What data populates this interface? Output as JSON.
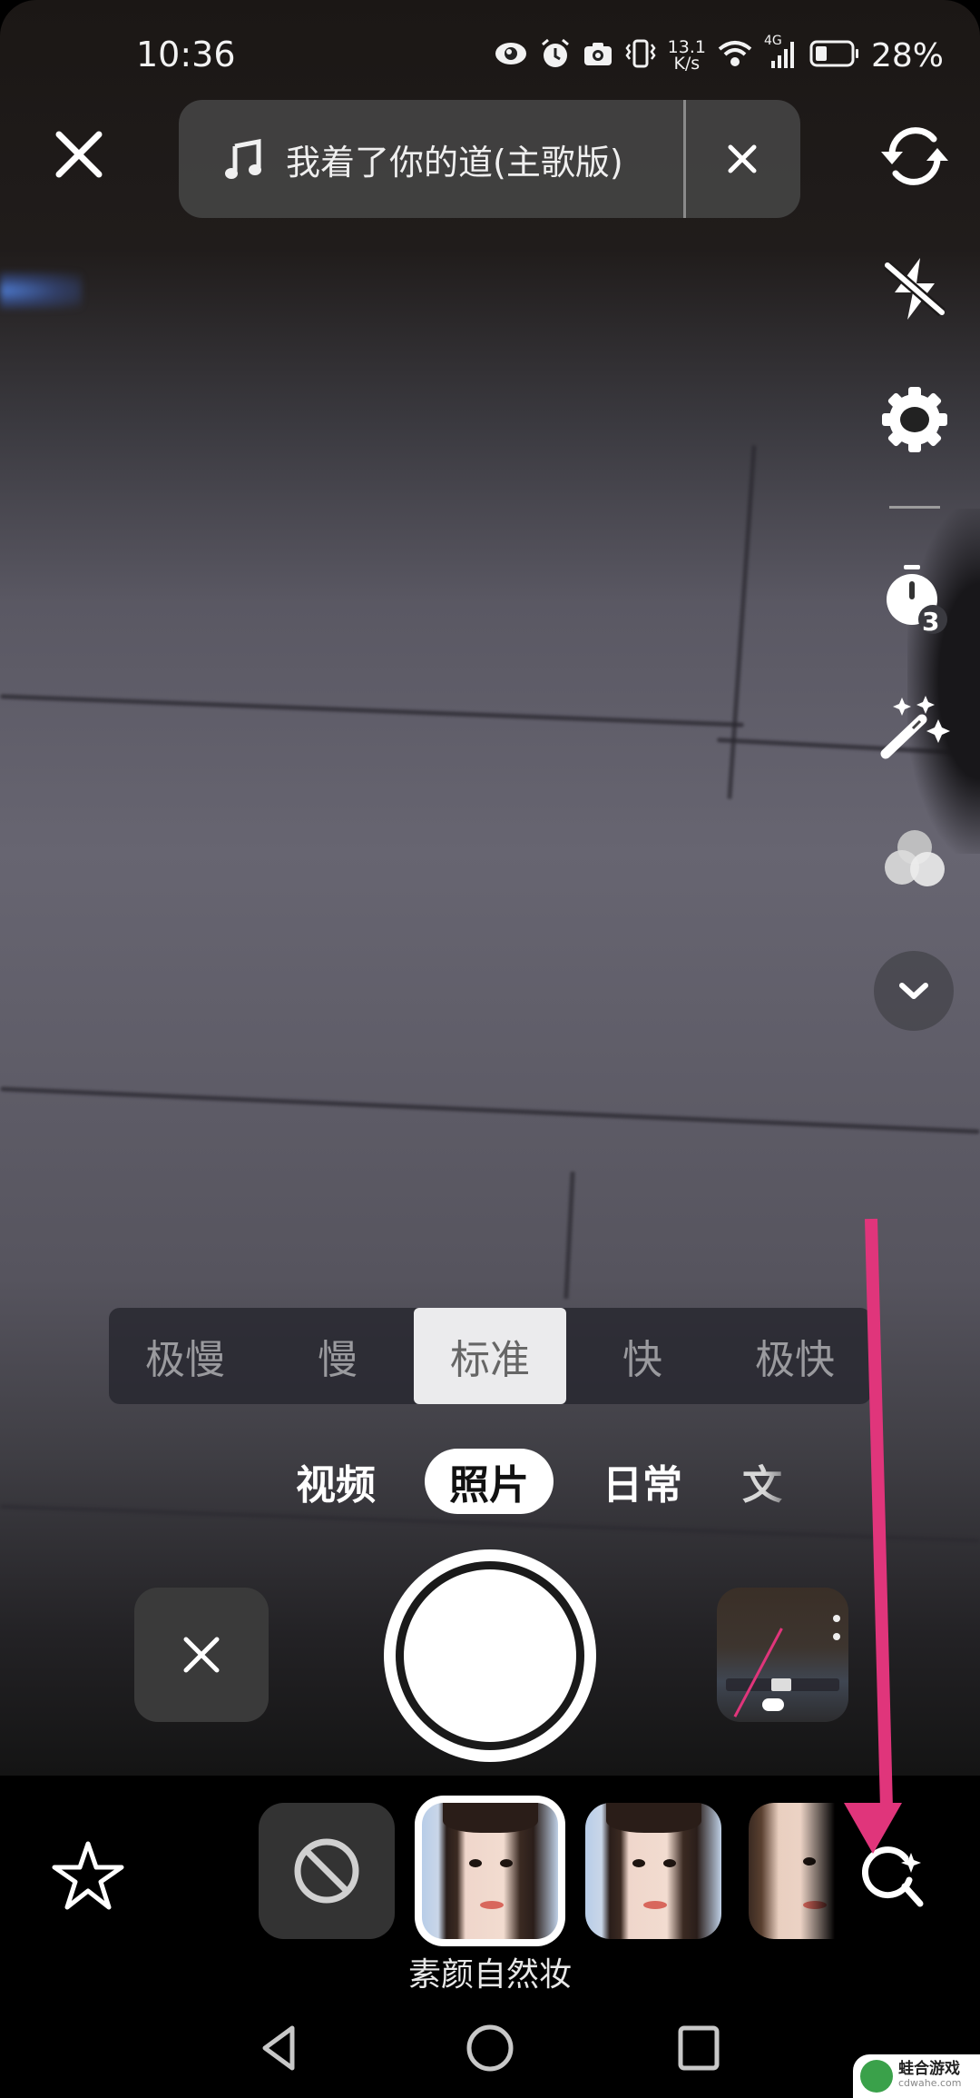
{
  "status_bar": {
    "time": "10:36",
    "net_speed_value": "13.1",
    "net_speed_unit": "K/s",
    "network_type": "4G",
    "battery_percent": "28%",
    "icons": [
      "eye-comfort-icon",
      "alarm-icon",
      "camera-icon",
      "vibrate-icon",
      "wifi-icon",
      "signal-icon",
      "battery-icon"
    ]
  },
  "top_bar": {
    "close_icon": "close-icon",
    "music": {
      "icon": "music-note-icon",
      "title": "我着了你的道(主歌版)",
      "remove_icon": "close-icon"
    },
    "flip_camera_icon": "flip-camera-icon"
  },
  "side_tools": [
    {
      "name": "flash-off",
      "icon": "flash-off-icon"
    },
    {
      "name": "settings",
      "icon": "gear-icon"
    },
    {
      "name": "timer",
      "icon": "timer-icon",
      "badge": "3"
    },
    {
      "name": "beauty",
      "icon": "magic-wand-icon"
    },
    {
      "name": "filters",
      "icon": "filter-circles-icon"
    },
    {
      "name": "more",
      "icon": "chevron-down-icon"
    }
  ],
  "speed_options": {
    "items": [
      "极慢",
      "慢",
      "标准",
      "快",
      "极快"
    ],
    "selected": "标准"
  },
  "modes": {
    "items": [
      "视频",
      "照片",
      "日常",
      "文"
    ],
    "selected": "照片"
  },
  "capture": {
    "cancel_icon": "close-icon",
    "shutter": "shutter-button",
    "thumbnail": "recent-thumbnail"
  },
  "effects": {
    "favorite_icon": "star-icon",
    "none_icon": "no-effect-icon",
    "selected_label": "素颜自然妆",
    "search_icon": "ai-search-icon"
  },
  "annotation": {
    "arrow_color": "#e0357b"
  },
  "nav_bar": {
    "back_icon": "back-triangle-icon",
    "home_icon": "home-circle-icon",
    "recents_icon": "recents-square-icon"
  },
  "watermark": {
    "name": "蛙合游戏",
    "domain": "cdwahe.com"
  }
}
